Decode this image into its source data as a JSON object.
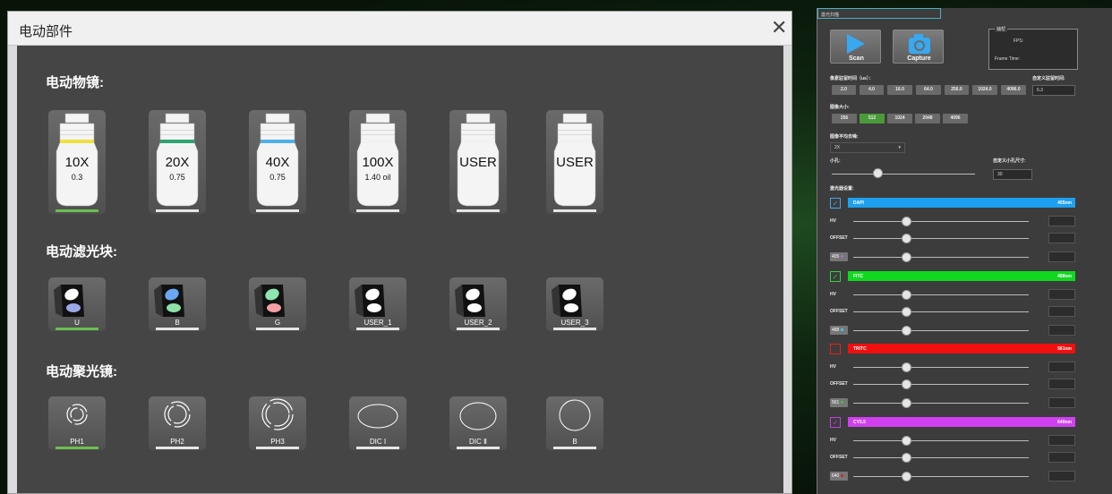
{
  "dialog": {
    "title": "电动部件",
    "close_glyph": "✕"
  },
  "objectives": {
    "heading": "电动物镜:",
    "items": [
      {
        "mag": "10X",
        "na": "0.3",
        "band": "#f0e040",
        "under": "#6abf50"
      },
      {
        "mag": "20X",
        "na": "0.75",
        "band": "#2fa46f",
        "under": "#e6e6e6"
      },
      {
        "mag": "40X",
        "na": "0.75",
        "band": "#4fb0e8",
        "under": "#e6e6e6"
      },
      {
        "mag": "100X",
        "na": "1.40 oil",
        "band": "#f2f2f2",
        "under": "#e6e6e6"
      },
      {
        "mag": "USER",
        "na": "",
        "band": "#f2f2f2",
        "under": "#e6e6e6"
      },
      {
        "mag": "USER",
        "na": "",
        "band": "#f2f2f2",
        "under": "#e6e6e6"
      }
    ]
  },
  "filters": {
    "heading": "电动滤光块:",
    "items": [
      {
        "label": "U",
        "top": "#ffffff",
        "bottom": "#9aa8e6",
        "under": "#6abf50"
      },
      {
        "label": "B",
        "top": "#6aa6f2",
        "bottom": "#8ee0a6",
        "under": "#e6e6e6"
      },
      {
        "label": "G",
        "top": "#8ee6b0",
        "bottom": "#f2a0a6",
        "under": "#e6e6e6"
      },
      {
        "label": "USER_1",
        "top": "#ffffff",
        "bottom": "#ffffff",
        "under": "#e6e6e6"
      },
      {
        "label": "USER_2",
        "top": "#ffffff",
        "bottom": "#ffffff",
        "under": "#e6e6e6"
      },
      {
        "label": "USER_3",
        "top": "#ffffff",
        "bottom": "#ffffff",
        "under": "#e6e6e6"
      }
    ]
  },
  "condensers": {
    "heading": "电动聚光镜:",
    "items": [
      {
        "label": "PH1",
        "under": "#6abf50"
      },
      {
        "label": "PH2",
        "under": "#e6e6e6"
      },
      {
        "label": "PH3",
        "under": "#e6e6e6"
      },
      {
        "label": "DIC Ⅰ",
        "under": "#e6e6e6"
      },
      {
        "label": "DIC Ⅱ",
        "under": "#e6e6e6"
      },
      {
        "label": "B",
        "under": "#e6e6e6"
      }
    ]
  },
  "panel": {
    "title": "激光扫描",
    "scan_label": "Scan",
    "capture_label": "Capture",
    "status_title": "辅帮",
    "fps_label": "FPS:",
    "frame_time_label": "Frame Time:",
    "dwell_label": "像素驻留时间（us）：",
    "dwell": [
      "2.0",
      "4.0",
      "16.0",
      "64.0",
      "256.0",
      "1024.0",
      "4096.0"
    ],
    "custom_dwell_label": "自定义驻留时间:",
    "custom_dwell_value": "6.3",
    "size_label": "图像大小:",
    "sizes": [
      "256",
      "512",
      "1024",
      "2048",
      "4096"
    ],
    "size_active": "512",
    "avg_label": "图像平均去噪:",
    "avg_value": "2X",
    "pinhole_label": "小孔:",
    "pinhole_value": "30",
    "pinhole_custom_label": "自定义小孔尺寸:",
    "laser_label": "激光器设置:",
    "hv_label": "HV",
    "offset_label": "OFFSET",
    "channels": [
      {
        "name": "DAPI",
        "wl": "405nm",
        "color": "#1ea0f0",
        "laser": "405",
        "laser_color": "#b06ad8",
        "check": "#4aa3e8"
      },
      {
        "name": "FITC",
        "wl": "488nm",
        "color": "#10d820",
        "laser": "488",
        "laser_color": "#3ad0e8",
        "check": "#35d040"
      },
      {
        "name": "TRITC",
        "wl": "561nm",
        "color": "#f01010",
        "laser": "561",
        "laser_color": "#37c837",
        "check": "#e82020"
      },
      {
        "name": "CY5.5",
        "wl": "640nm",
        "color": "#d040f0",
        "laser": "640",
        "laser_color": "#e02020",
        "check": "#c040e0"
      }
    ]
  }
}
